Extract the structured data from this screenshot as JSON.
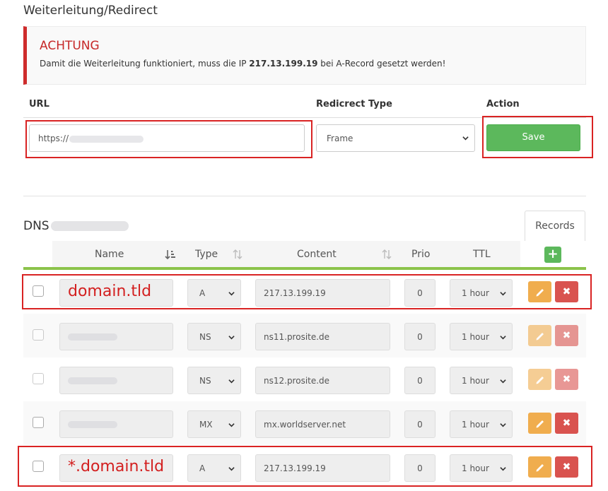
{
  "redirect": {
    "title": "Weiterleitung/Redirect",
    "alert_title": "ACHTUNG",
    "alert_text_before": "Damit die Weiterleitung funktioniert, muss die IP ",
    "alert_ip": "217.13.199.19",
    "alert_text_after": " bei A-Record gesetzt werden!",
    "col_url": "URL",
    "col_type": "Redicrect Type",
    "col_action": "Action",
    "url_value": "https://",
    "type_value": "Frame",
    "save_label": "Save"
  },
  "dns": {
    "title": "DNS",
    "tab_records": "Records",
    "columns": {
      "name": "Name",
      "type": "Type",
      "content": "Content",
      "prio": "Prio",
      "ttl": "TTL"
    },
    "add_label": "+",
    "rows": [
      {
        "name": "domain.tld",
        "type": "A",
        "content": "217.13.199.19",
        "prio": "0",
        "ttl": "1 hour"
      },
      {
        "name": "",
        "type": "NS",
        "content": "ns11.prosite.de",
        "prio": "0",
        "ttl": "1 hour"
      },
      {
        "name": "",
        "type": "NS",
        "content": "ns12.prosite.de",
        "prio": "0",
        "ttl": "1 hour"
      },
      {
        "name": "",
        "type": "MX",
        "content": "mx.worldserver.net",
        "prio": "0",
        "ttl": "1 hour"
      },
      {
        "name": "*.domain.tld",
        "type": "A",
        "content": "217.13.199.19",
        "prio": "0",
        "ttl": "1 hour"
      }
    ],
    "delete_glyph": "✖"
  },
  "colors": {
    "accent_green": "#5cb85c",
    "header_green_line": "#8bc34a",
    "alert_red": "#c62828",
    "highlight_red": "#d92323",
    "edit_orange": "#f0ad4e",
    "delete_red": "#d9534f"
  },
  "icons": [
    "sort-name-icon",
    "sort-type-icon",
    "sort-content-icon",
    "chevron-down-icon",
    "plus-icon",
    "pencil-icon",
    "delete-icon"
  ]
}
